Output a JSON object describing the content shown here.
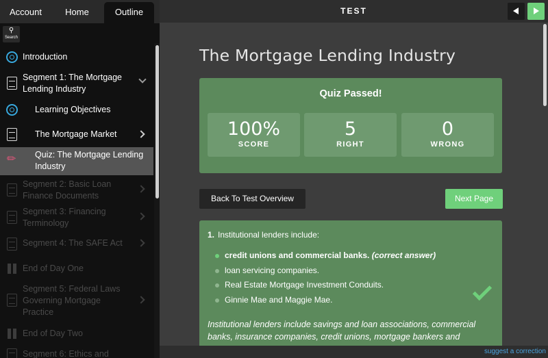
{
  "tabs": {
    "account": "Account",
    "home": "Home",
    "outline": "Outline"
  },
  "search": {
    "label": "Search"
  },
  "outline": {
    "introduction": "Introduction",
    "segment1": "Segment 1: The Mortgage Lending Industry",
    "learning_objectives": "Learning Objectives",
    "mortgage_market": "The Mortgage Market",
    "quiz": "Quiz: The Mortgage Lending Industry",
    "segment2": "Segment 2: Basic Loan Finance Documents",
    "segment3": "Segment 3: Financing Terminology",
    "segment4": "Segment 4: The SAFE Act",
    "end_day_one": "End of Day One",
    "segment5": "Segment 5: Federal Laws Governing Mortgage Practice",
    "end_day_two": "End of Day Two",
    "segment6": "Segment 6: Ethics and"
  },
  "header": {
    "title": "TEST"
  },
  "page": {
    "title": "The Mortgage Lending Industry"
  },
  "result": {
    "title": "Quiz Passed!",
    "score_value": "100%",
    "score_label": "SCORE",
    "right_value": "5",
    "right_label": "RIGHT",
    "wrong_value": "0",
    "wrong_label": "WRONG"
  },
  "buttons": {
    "back": "Back To Test Overview",
    "next_page": "Next Page"
  },
  "question": {
    "number": "1.",
    "text": "Institutional lenders include:",
    "answers": [
      "credit unions and commercial banks.",
      "loan servicing companies.",
      "Real Estate Mortgage Investment Conduits.",
      "Ginnie Mae and Maggie Mae."
    ],
    "correct_note": "(correct answer)",
    "explanation": "Institutional lenders include savings and loan associations, commercial banks, insurance companies, credit unions, mortgage bankers and"
  },
  "footer": {
    "suggest": "suggest a correction"
  },
  "colors": {
    "accent_green": "#6fd07b",
    "card_green": "#5c8a5c",
    "target_blue": "#38a8dd",
    "link_blue": "#4aa3df"
  }
}
